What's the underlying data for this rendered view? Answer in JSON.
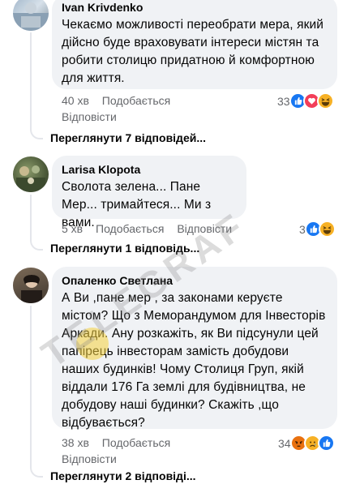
{
  "comments": [
    {
      "author": "Ivan Krivdenko",
      "text": "Чекаємо можливості переобрати мера, який дійсно буде враховувати інтереси містян та робити столицю придатною й комфортною для життя.",
      "time": "40 хв",
      "like": "Подобається",
      "reply": "Відповісти",
      "reaction_count": "33",
      "reactions": [
        "like-icon",
        "heart-icon",
        "haha-icon"
      ],
      "replies_link": "Переглянути 7 відповідей..."
    },
    {
      "author": "Larisa Klopota",
      "text": "Сволота зелена... Пане Мер... тримайтеся... Ми з вами.",
      "time": "5 хв",
      "like": "Подобається",
      "reply": "Відповісти",
      "reaction_count": "3",
      "reactions": [
        "like-icon",
        "haha-icon"
      ],
      "replies_link": "Переглянути 1 відповідь..."
    },
    {
      "author": "Опаленко Светлана",
      "text": "А Ви ,пане мер , за законами керуєте містом? Що з Меморандумом для Інвесторів Аркади. Ану розкажіть, як Ви підсунули цей папірець інвесторам замість добудови наших будинків! Чому Столиця Груп, якій віддали 176 Га землі для будівництва, не добудову наші будинки? Скажіть ,що відбувається?",
      "time": "38 хв",
      "like": "Подобається",
      "reply": "Відповісти",
      "reaction_count": "34",
      "reactions": [
        "angry-icon",
        "sad-icon",
        "like-icon"
      ],
      "replies_link": "Переглянути 2 відповіді..."
    }
  ],
  "watermark": "TELEGRAF",
  "colors": {
    "bubble": "#f0f2f5",
    "meta_text": "#65676b",
    "like_blue": "#1877f2",
    "heart_red": "#f33e58",
    "haha_yellow": "#f7b125",
    "angry_orange": "#e9710f"
  }
}
